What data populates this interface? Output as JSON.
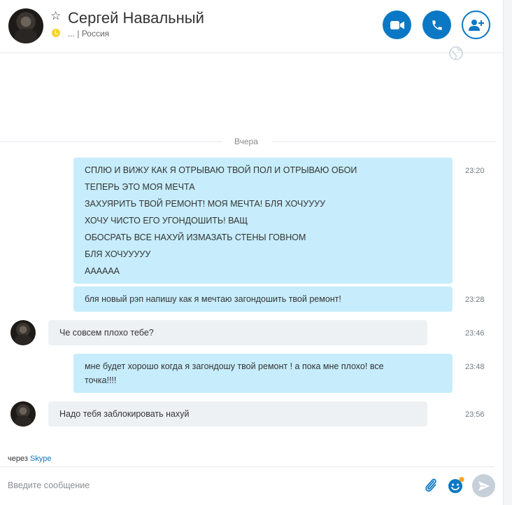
{
  "header": {
    "contact_name": "Сергей Навальный",
    "status_prefix": "...",
    "status_separator": "|",
    "location": "Россия",
    "icons": {
      "favorite": "star-outline-icon",
      "status": "away-clock-icon",
      "video": "video-camera-icon",
      "call": "phone-icon",
      "add": "add-person-icon",
      "translate": "globe-icon"
    }
  },
  "day_divider": "Вчера",
  "messages": [
    {
      "direction": "out",
      "time": "23:20",
      "lines": [
        "СПЛЮ И ВИЖУ КАК Я ОТРЫВАЮ ТВОЙ ПОЛ  И ОТРЫВАЮ ОБОИ",
        "ТЕПЕРЬ ЭТО МОЯ МЕЧТА",
        "ЗАХУЯРИТЬ ТВОЙ РЕМОНТ! МОЯ МЕЧТА! БЛЯ ХОЧУУУУ",
        "ХОЧУ ЧИСТО ЕГО УГОНДОШИТЬ! ВАЩ",
        "ОБОСРАТЬ ВСЕ НАХУЙ ИЗМАЗАТЬ СТЕНЫ ГОВНОМ",
        "БЛЯ ХОЧУУУУУ",
        "АААААА"
      ]
    },
    {
      "direction": "out",
      "time": "23:28",
      "lines": [
        "бля новый рэп напишу как я мечтаю загондошить твой ремонт!"
      ]
    },
    {
      "direction": "in",
      "time": "23:46",
      "lines": [
        "Че совсем плохо тебе?"
      ]
    },
    {
      "direction": "out",
      "time": "23:48",
      "lines": [
        "мне будет хорошо когда я загондошу твой ремонт ! а пока мне плохо! все",
        "точка!!!!"
      ]
    },
    {
      "direction": "in",
      "time": "23:56",
      "lines": [
        "Надо тебя заблокировать нахуй"
      ]
    }
  ],
  "footer": {
    "via_prefix": "через",
    "via_link": "Skype",
    "input_placeholder": "Введите сообщение",
    "input_value": ""
  },
  "colors": {
    "accent": "#0a78c4",
    "outgoing_bubble": "#c7edfc",
    "incoming_bubble": "#eef1f4",
    "away_status": "#f8d22f",
    "send_disabled": "#c7d0da"
  }
}
